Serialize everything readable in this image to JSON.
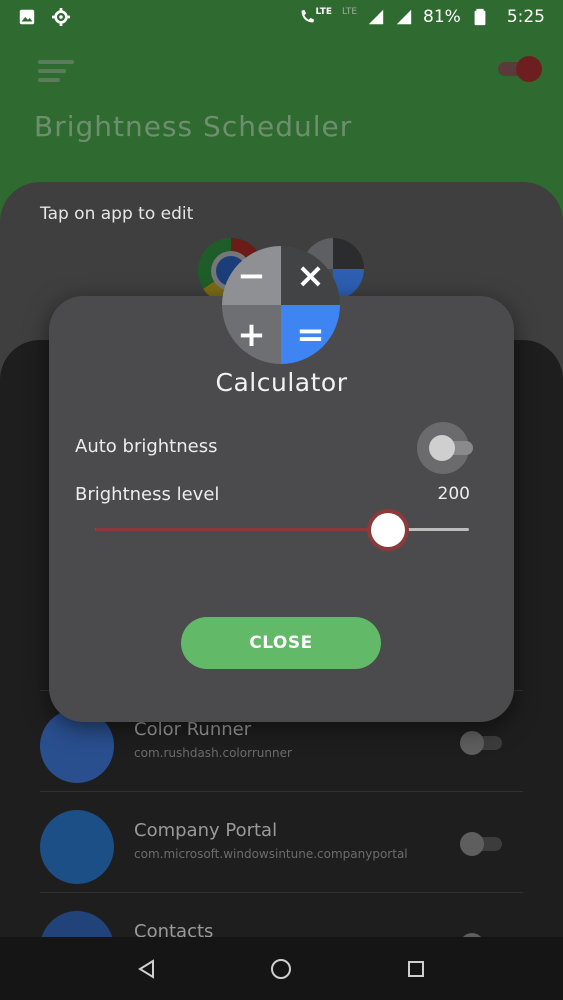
{
  "status_bar": {
    "network": "LTE",
    "network2": "LTE",
    "battery": "81%",
    "time": "5:25"
  },
  "app": {
    "title": "Brightness Scheduler",
    "edit_label": "Tap on app to edit"
  },
  "list": {
    "items": [
      {
        "name": "Color Runner",
        "package": "com.rushdash.colorrunner",
        "avatar_color": "#2a4f8f"
      },
      {
        "name": "Company Portal",
        "package": "com.microsoft.windowsintune.companyportal",
        "avatar_color": "#1c4f86"
      },
      {
        "name": "Contacts",
        "package": "",
        "avatar_color": "#22437a"
      }
    ]
  },
  "dialog": {
    "app_name": "Calculator",
    "auto_brightness_label": "Auto brightness",
    "auto_brightness_on": false,
    "brightness_level_label": "Brightness level",
    "brightness_value": "200",
    "brightness_fraction": 0.784,
    "close_label": "CLOSE",
    "icon_glyphs": {
      "minus": "−",
      "times": "×",
      "plus": "+",
      "equals": "="
    }
  },
  "colors": {
    "accent_green": "#62b968",
    "slider_fill": "#8b3a3a",
    "header_green": "#2f6a30"
  }
}
